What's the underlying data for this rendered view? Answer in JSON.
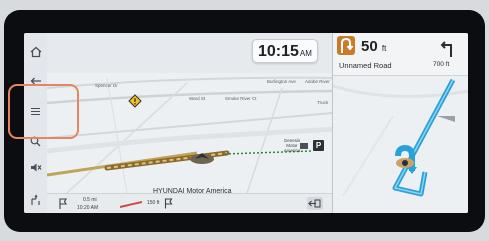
{
  "status": {
    "time": "10:15",
    "ampm": "AM"
  },
  "maneuver": {
    "distance": "50",
    "unit": "ft",
    "road_name": "Unnamed Road",
    "next_distance": "700 ft"
  },
  "map": {
    "streets": [
      "Spencer Dr",
      "Ward St",
      "Smoke River Ct",
      "Burlington Ave",
      "Adobe River",
      "Truck"
    ],
    "poi": {
      "name_line1": "Genesis",
      "name_line2": "Motor",
      "name_line3": "America",
      "parking": "P"
    }
  },
  "trip": {
    "distance_remaining": "0.5 mi",
    "arrival_time": "10:20 AM",
    "speed_value": "150 ft",
    "destination": "HYUNDAI Motor America"
  },
  "icons": [
    "home-icon",
    "back-arrow-icon",
    "menu-icon",
    "zoom-icon",
    "mute-icon",
    "route-overview-icon",
    "warning-icon",
    "parking-icon",
    "flag-icon",
    "exit-icon"
  ],
  "colors": {
    "route": "#2aa0d8",
    "maneuver_arrow": "#c97a2b",
    "highlight": "#e8845e",
    "warning": "#f2c21b"
  }
}
